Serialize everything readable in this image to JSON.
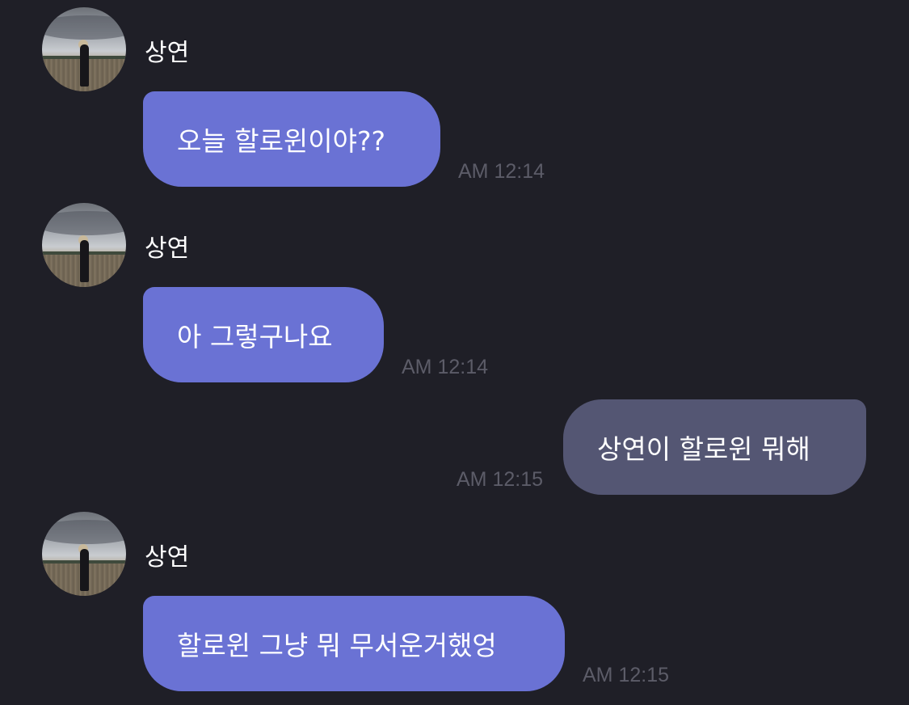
{
  "messages": [
    {
      "direction": "incoming",
      "sender": "상연",
      "text": "오늘 할로윈이야??",
      "time": "AM 12:14"
    },
    {
      "direction": "incoming",
      "sender": "상연",
      "text": "아 그렇구나요",
      "time": "AM 12:14"
    },
    {
      "direction": "outgoing",
      "text": "상연이 할로윈 뭐해",
      "time": "AM 12:15"
    },
    {
      "direction": "incoming",
      "sender": "상연",
      "text": "할로윈 그냥 뭐 무서운거했엉",
      "time": "AM 12:15"
    }
  ],
  "colors": {
    "background": "#1f1f27",
    "incoming_bubble": "#6a72d4",
    "outgoing_bubble": "#545673",
    "timestamp": "#5c5c68",
    "text": "#ffffff"
  }
}
